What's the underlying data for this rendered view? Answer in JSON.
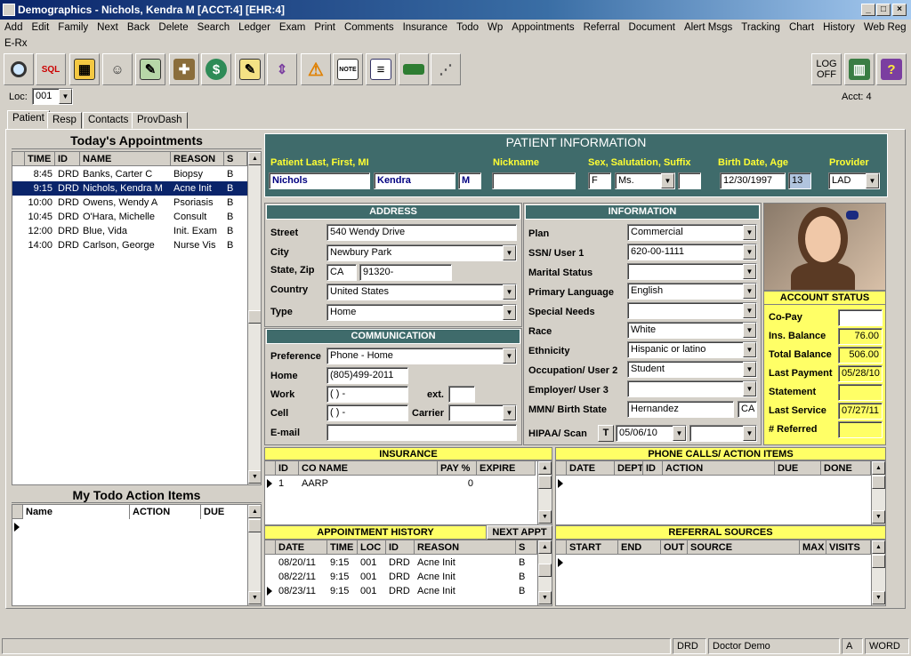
{
  "window": {
    "title": "Demographics - Nichols, Kendra M [ACCT:4] [EHR:4]"
  },
  "menu": [
    "Add",
    "Edit",
    "Family",
    "Next",
    "Back",
    "Delete",
    "Search",
    "Ledger",
    "Exam",
    "Print",
    "Comments",
    "Insurance",
    "Todo",
    "Wp",
    "Appointments",
    "Referral",
    "Document",
    "Alert Msgs",
    "Tracking",
    "Chart",
    "History",
    "Web Reg"
  ],
  "menu_row2": [
    "E-Rx"
  ],
  "toolbar": {
    "logoff_line1": "LOG",
    "logoff_line2": "OFF",
    "sql_label": "SQL",
    "note_label": "NOTE"
  },
  "loc": {
    "label": "Loc:",
    "value": "001",
    "acct": "Acct: 4"
  },
  "tabs": [
    "Patient",
    "Resp",
    "Contacts",
    "ProvDash"
  ],
  "appointments": {
    "title": "Today's Appointments",
    "columns": [
      "TIME",
      "ID",
      "NAME",
      "REASON",
      "S"
    ],
    "rows": [
      [
        "8:45",
        "DRD",
        "Banks, Carter C",
        "Biopsy",
        "B"
      ],
      [
        "9:15",
        "DRD",
        "Nichols, Kendra M",
        "Acne Init",
        "B"
      ],
      [
        "10:00",
        "DRD",
        "Owens, Wendy A",
        "Psoriasis",
        "B"
      ],
      [
        "10:45",
        "DRD",
        "O'Hara, Michelle",
        "Consult",
        "B"
      ],
      [
        "12:00",
        "DRD",
        "Blue, Vida",
        "Init. Exam",
        "B"
      ],
      [
        "14:00",
        "DRD",
        "Carlson, George",
        "Nurse Vis",
        "B"
      ]
    ]
  },
  "todo": {
    "title": "My Todo Action Items",
    "columns": [
      "Name",
      "ACTION",
      "DUE"
    ]
  },
  "patient": {
    "header": "PATIENT INFORMATION",
    "labels": {
      "name": "Patient Last, First, MI",
      "nickname": "Nickname",
      "sex": "Sex, Salutation, Suffix",
      "birth": "Birth Date, Age",
      "provider": "Provider"
    },
    "last": "Nichols",
    "first": "Kendra",
    "mi": "M",
    "nickname": "",
    "sex": "F",
    "salutation": "Ms.",
    "suffix": "",
    "birthdate": "12/30/1997",
    "age": "13",
    "provider": "LAD"
  },
  "address": {
    "header": "ADDRESS",
    "street_label": "Street",
    "street": "540 Wendy Drive",
    "city_label": "City",
    "city": "Newbury Park",
    "state_label": "State, Zip",
    "state": "CA",
    "zip": "91320-",
    "country_label": "Country",
    "country": "United States",
    "type_label": "Type",
    "type": "Home"
  },
  "communication": {
    "header": "COMMUNICATION",
    "pref_label": "Preference",
    "pref": "Phone - Home",
    "home_label": "Home",
    "home": "(805)499-2011",
    "work_label": "Work",
    "work": "(  )  -",
    "ext_label": "ext.",
    "cell_label": "Cell",
    "cell": "(  )  -",
    "carrier_label": "Carrier",
    "email_label": "E-mail"
  },
  "information": {
    "header": "INFORMATION",
    "fields": [
      {
        "label": "Plan",
        "value": "Commercial"
      },
      {
        "label": "SSN/ User 1",
        "value": "620-00-1111"
      },
      {
        "label": "Marital Status",
        "value": ""
      },
      {
        "label": "Primary Language",
        "value": "English"
      },
      {
        "label": "Special Needs",
        "value": ""
      },
      {
        "label": "Race",
        "value": "White"
      },
      {
        "label": "Ethnicity",
        "value": "Hispanic or latino"
      },
      {
        "label": "Occupation/ User 2",
        "value": "Student"
      },
      {
        "label": "Employer/ User 3",
        "value": ""
      }
    ],
    "mmn_label": "MMN/ Birth State",
    "mmn": "Hernandez",
    "birth_state": "CA",
    "hipaa_label": "HIPAA/ Scan",
    "hipaa_t": "T",
    "hipaa_date": "05/06/10"
  },
  "account": {
    "header": "ACCOUNT STATUS",
    "rows": [
      {
        "label": "Co-Pay",
        "value": ""
      },
      {
        "label": "Ins. Balance",
        "value": "76.00"
      },
      {
        "label": "Total Balance",
        "value": "506.00"
      },
      {
        "label": "Last Payment",
        "value": "05/28/10"
      },
      {
        "label": "Statement",
        "value": ""
      },
      {
        "label": "Last Service",
        "value": "07/27/11"
      },
      {
        "label": "# Referred",
        "value": ""
      }
    ]
  },
  "insurance": {
    "header": "INSURANCE",
    "columns": [
      "ID",
      "CO NAME",
      "PAY %",
      "EXPIRE"
    ],
    "rows": [
      [
        "1",
        "AARP",
        "0",
        ""
      ]
    ]
  },
  "phone_calls": {
    "header": "PHONE CALLS/ ACTION ITEMS",
    "columns": [
      "DATE",
      "DEPT",
      "ID",
      "ACTION",
      "DUE",
      "DONE"
    ]
  },
  "appt_history": {
    "header": "APPOINTMENT HISTORY",
    "next": "NEXT APPT",
    "columns": [
      "DATE",
      "TIME",
      "LOC",
      "ID",
      "REASON",
      "S"
    ],
    "rows": [
      [
        "08/20/11",
        "9:15",
        "001",
        "DRD",
        "Acne Init",
        "B"
      ],
      [
        "08/22/11",
        "9:15",
        "001",
        "DRD",
        "Acne Init",
        "B"
      ],
      [
        "08/23/11",
        "9:15",
        "001",
        "DRD",
        "Acne Init",
        "B"
      ]
    ]
  },
  "referral": {
    "header": "REFERRAL SOURCES",
    "columns": [
      "START",
      "END",
      "OUT",
      "SOURCE",
      "MAX",
      "VISITS"
    ]
  },
  "statusbar": {
    "user": "DRD",
    "name": "Doctor Demo",
    "mode": "A",
    "app": "WORD"
  },
  "colors": {
    "teal": "#3f6b6b",
    "yellow": "#ffff66",
    "label_yellow": "#ffff33",
    "title_blue": "#0a246a"
  }
}
